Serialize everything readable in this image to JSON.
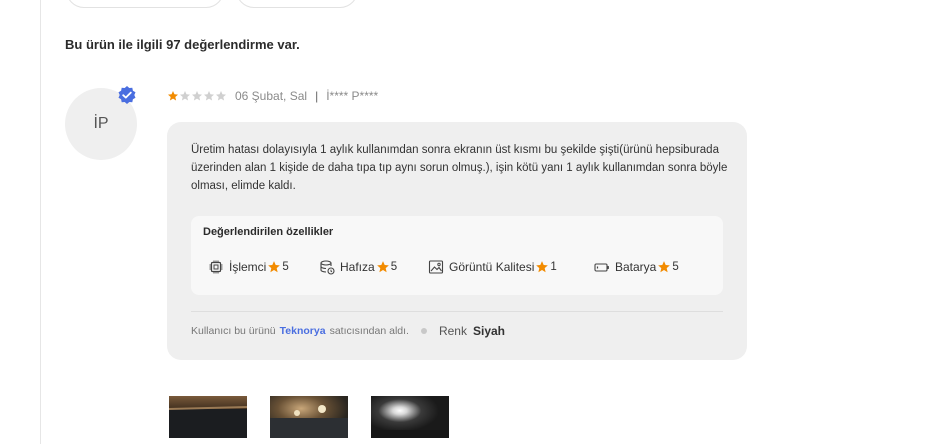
{
  "review_count_text": "Bu ürün ile ilgili 97 değerlendirme var.",
  "review": {
    "avatar_initials": "İP",
    "rating": 1,
    "max_rating": 5,
    "date": "06 Şubat, Sal",
    "separator": "|",
    "author": "İ**** P****",
    "text": "Üretim hatası dolayısıyla 1 aylık kullanımdan sonra ekranın üst kısmı bu şekilde şişti(ürünü hepsiburada üzerinden alan 1 kişide de daha tıpa tıp aynı sorun olmuş.), işin kötü yanı 1 aylık kullanımdan sonra böyle olması, elimde kaldı.",
    "features_title": "Değerlendirilen özellikler",
    "features": [
      {
        "icon": "processor-icon",
        "label": "İşlemci",
        "score": "5"
      },
      {
        "icon": "memory-icon",
        "label": "Hafıza",
        "score": "5"
      },
      {
        "icon": "image-quality-icon",
        "label": "Görüntü Kalitesi",
        "score": "1"
      },
      {
        "icon": "battery-icon",
        "label": "Batarya",
        "score": "5"
      }
    ],
    "seller_prefix": "Kullanıcı bu ürünü",
    "seller_name": "Teknorya",
    "seller_suffix": "satıcısından aldı.",
    "color_label": "Renk",
    "color_value": "Siyah",
    "photos": [
      "review-photo-1",
      "review-photo-2",
      "review-photo-3"
    ]
  },
  "colors": {
    "star": "#f28b00",
    "star_empty": "#d0d0d0",
    "verified": "#4a6ee0",
    "link": "#4a6ee0"
  }
}
